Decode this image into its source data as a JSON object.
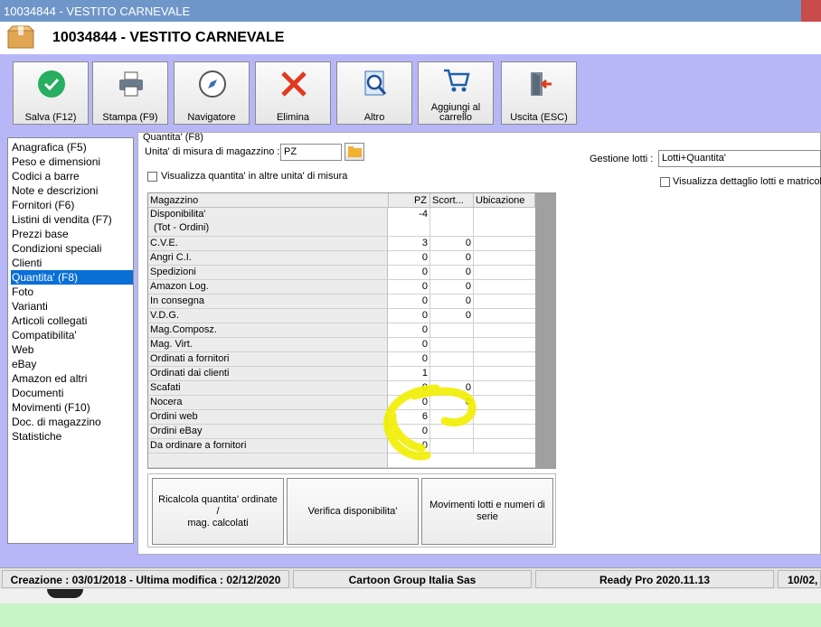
{
  "window": {
    "title": "10034844 - VESTITO CARNEVALE"
  },
  "header": {
    "title": "10034844 - VESTITO CARNEVALE"
  },
  "toolbar": {
    "save": "Salva (F12)",
    "print": "Stampa (F9)",
    "navigator": "Navigatore",
    "delete": "Elimina",
    "other": "Altro",
    "cart_line1": "Aggiungi al",
    "cart_line2": "carrello",
    "exit": "Uscita (ESC)"
  },
  "nav": {
    "items": [
      "Anagrafica (F5)",
      "Peso e dimensioni",
      "Codici a barre",
      "Note e descrizioni",
      "Fornitori (F6)",
      "Listini di vendita (F7)",
      "Prezzi base",
      "Condizioni speciali",
      "Clienti",
      "Quantita' (F8)",
      "Foto",
      "Varianti",
      "Articoli collegati",
      "Compatibilita'",
      "Web",
      "eBay",
      "Amazon ed altri",
      "Documenti",
      "Movimenti (F10)",
      "Doc. di magazzino",
      "Statistiche"
    ],
    "selected_index": 9
  },
  "panel": {
    "group_title": "Quantita' (F8)",
    "uom_label": "Unita' di misura di magazzino :",
    "uom_value": "PZ",
    "show_other_units_label": "Visualizza quantita' in altre unita' di misura",
    "lots_label": "Gestione lotti :",
    "lots_value": "Lotti+Quantita'",
    "show_lot_detail_label": "Visualizza dettaglio lotti e matricole"
  },
  "grid": {
    "headers": {
      "warehouse": "Magazzino",
      "pz": "PZ",
      "stock": "Scort...",
      "location": "Ubicazione"
    },
    "rows": [
      {
        "name": "Disponibilita'",
        "name2": "(Tot - Ordini)",
        "pz": "-4",
        "scorta": ""
      },
      {
        "name": "C.V.E.",
        "pz": "3",
        "scorta": "0"
      },
      {
        "name": "Angri C.I.",
        "pz": "0",
        "scorta": "0"
      },
      {
        "name": "Spedizioni",
        "pz": "0",
        "scorta": "0"
      },
      {
        "name": "Amazon Log.",
        "pz": "0",
        "scorta": "0"
      },
      {
        "name": "In consegna",
        "pz": "0",
        "scorta": "0"
      },
      {
        "name": "V.D.G.",
        "pz": "0",
        "scorta": "0"
      },
      {
        "name": "Mag.Composz.",
        "pz": "0",
        "scorta": ""
      },
      {
        "name": "Mag. Virt.",
        "pz": "0",
        "scorta": ""
      },
      {
        "name": "Ordinati a fornitori",
        "pz": "0",
        "scorta": ""
      },
      {
        "name": "Ordinati dai clienti",
        "pz": "1",
        "scorta": ""
      },
      {
        "name": "Scafati",
        "pz": "0",
        "scorta": "0"
      },
      {
        "name": "Nocera",
        "pz": "0",
        "scorta": "0"
      },
      {
        "name": "Ordini web",
        "pz": "6",
        "scorta": ""
      },
      {
        "name": "Ordini eBay",
        "pz": "0",
        "scorta": ""
      },
      {
        "name": "Da ordinare a fornitori",
        "pz": "0",
        "scorta": ""
      }
    ]
  },
  "actions": {
    "recalc_line1": "Ricalcola quantita' ordinate /",
    "recalc_line2": "mag. calcolati",
    "check": "Verifica disponibilita'",
    "lots_line1": "Movimenti lotti e numeri di",
    "lots_line2": "serie"
  },
  "status": {
    "dates": "Creazione : 03/01/2018 - Ultima modifica : 02/12/2020",
    "company": "Cartoon Group Italia Sas",
    "version": "Ready Pro 2020.11.13",
    "date_right": "10/02,"
  },
  "colors": {
    "accent_lavender": "#b7b7f7",
    "selection": "#0a6fd6",
    "highlight": "#f5f500"
  }
}
